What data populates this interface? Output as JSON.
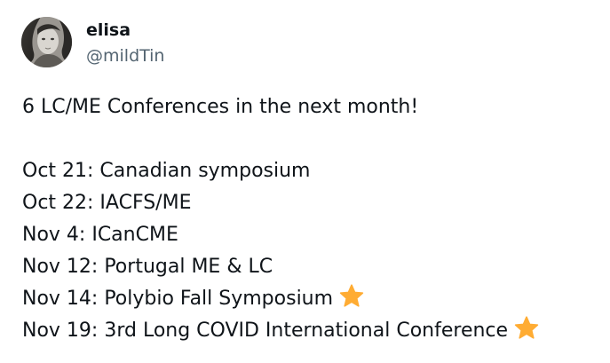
{
  "author": {
    "display_name": "elisa",
    "handle": "@mildTin",
    "avatar_icon": "user-avatar-photo"
  },
  "tweet": {
    "intro": "6 LC/ME Conferences in the next month!",
    "lines": [
      {
        "text": "Oct 21: Canadian symposium",
        "star": false
      },
      {
        "text": "Oct 22: IACFS/ME",
        "star": false
      },
      {
        "text": "Nov 4: ICanCME",
        "star": false
      },
      {
        "text": "Nov 12: Portugal ME & LC",
        "star": false
      },
      {
        "text": "Nov 14: Polybio Fall Symposium",
        "star": true
      },
      {
        "text": "Nov 19: 3rd Long COVID International Conference",
        "star": true
      }
    ]
  },
  "colors": {
    "text": "#0f1419",
    "handle": "#536471",
    "star": "#ffac33"
  },
  "icons": {
    "star": "star-icon"
  }
}
